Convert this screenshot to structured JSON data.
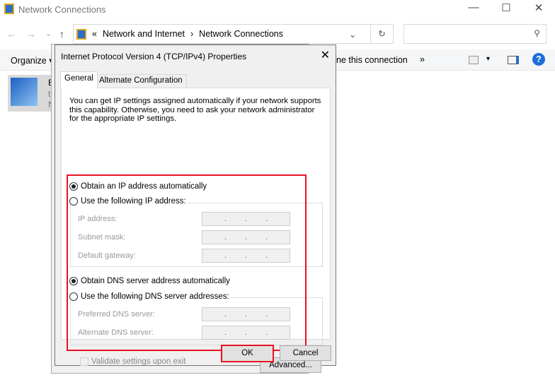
{
  "window": {
    "title": "Network Connections",
    "minimize": "—",
    "maximize": "☐",
    "close": "✕"
  },
  "nav": {
    "back": "←",
    "forward": "→",
    "recent": "⌄",
    "up": "↑"
  },
  "address": {
    "prefix": "«",
    "crumbs": [
      "Network and Internet",
      "Network Connections"
    ],
    "sep": "›",
    "dropdown": "⌄",
    "refresh": "↻"
  },
  "search": {
    "icon": "search-icon",
    "glyph": "⚲",
    "placeholder": ""
  },
  "toolbar": {
    "organize": "Organize ▾",
    "rename": "ne this connection",
    "more": "»",
    "view": "▾",
    "help": "?"
  },
  "connection": {
    "name_initial": "E",
    "line2": "t",
    "line3": "N"
  },
  "dialog": {
    "title": "Internet Protocol Version 4 (TCP/IPv4) Properties",
    "close": "✕",
    "tabs": [
      {
        "label": "General",
        "active": true
      },
      {
        "label": "Alternate Configuration",
        "active": false
      }
    ],
    "description": "You can get IP settings assigned automatically if your network supports this capability. Otherwise, you need to ask your network administrator for the appropriate IP settings.",
    "ip_auto": {
      "label": "Obtain an IP address automatically",
      "selected": true
    },
    "ip_manual": {
      "label": "Use the following IP address:",
      "selected": false
    },
    "ip_fields": [
      {
        "label": "IP address:"
      },
      {
        "label": "Subnet mask:"
      },
      {
        "label": "Default gateway:"
      }
    ],
    "dns_auto": {
      "label": "Obtain DNS server address automatically",
      "selected": true
    },
    "dns_manual": {
      "label": "Use the following DNS server addresses:",
      "selected": false
    },
    "dns_fields": [
      {
        "label": "Preferred DNS server:"
      },
      {
        "label": "Alternate DNS server:"
      }
    ],
    "validate": {
      "label": "Validate settings upon exit",
      "checked": false
    },
    "advanced": "Advanced...",
    "ok": "OK",
    "cancel": "Cancel",
    "highlight_color": "#e81123"
  }
}
